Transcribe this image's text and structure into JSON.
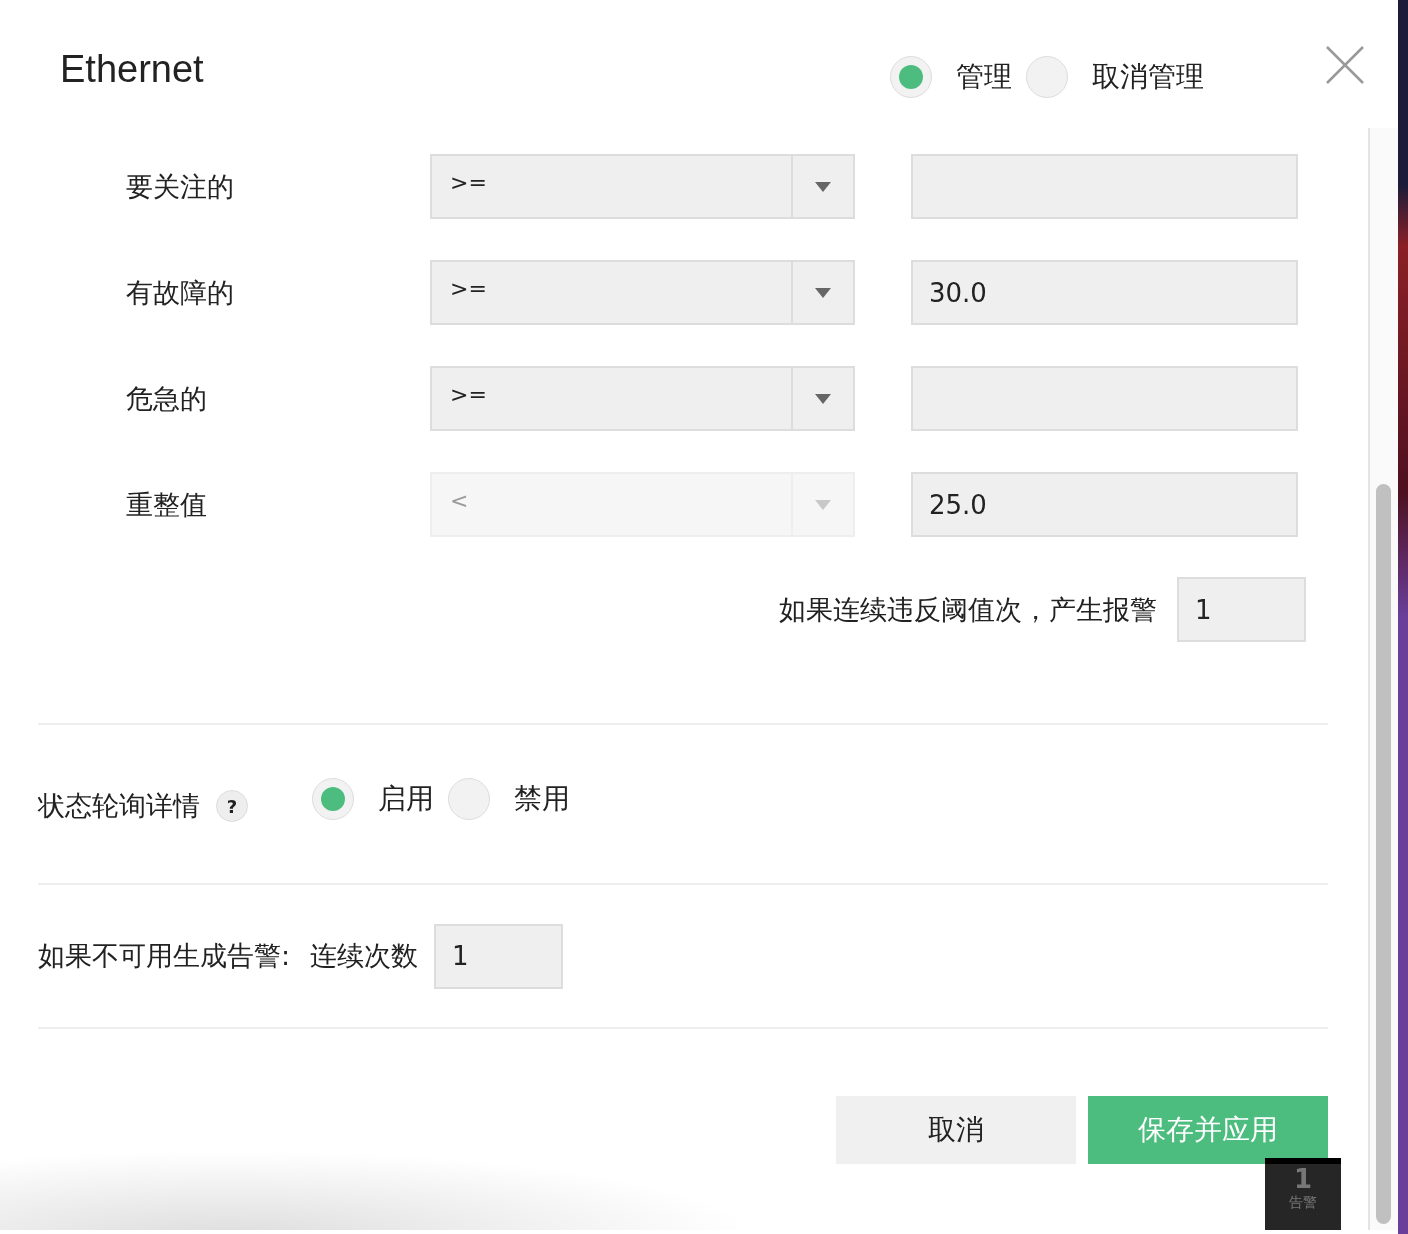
{
  "title": "Ethernet",
  "manage_options": [
    {
      "label": "管理",
      "selected": true
    },
    {
      "label": "取消管理",
      "selected": false
    }
  ],
  "thresholds": [
    {
      "label": "要关注的",
      "operator": ">=",
      "disabled": false
    },
    {
      "label": "有故障的",
      "operator": ">=",
      "disabled": false,
      "value": "30.0"
    },
    {
      "label": "危急的",
      "operator": ">=",
      "disabled": false
    },
    {
      "label": "重整值",
      "operator": "<",
      "disabled": true,
      "value": "25.0"
    }
  ],
  "consecutive_violation": {
    "label": "如果连续违反阈值次，产生报警",
    "value": "1"
  },
  "status_polling": {
    "label": "状态轮询详情",
    "help": "?",
    "options": [
      {
        "label": "启用",
        "selected": true
      },
      {
        "label": "禁用",
        "selected": false
      }
    ]
  },
  "unavailable_alert": {
    "label": "如果不可用生成告警:",
    "sublabel": "连续次数",
    "value": "1"
  },
  "buttons": {
    "cancel": "取消",
    "save": "保存并应用"
  },
  "alert_badge": {
    "count": "1",
    "label": "告警"
  }
}
